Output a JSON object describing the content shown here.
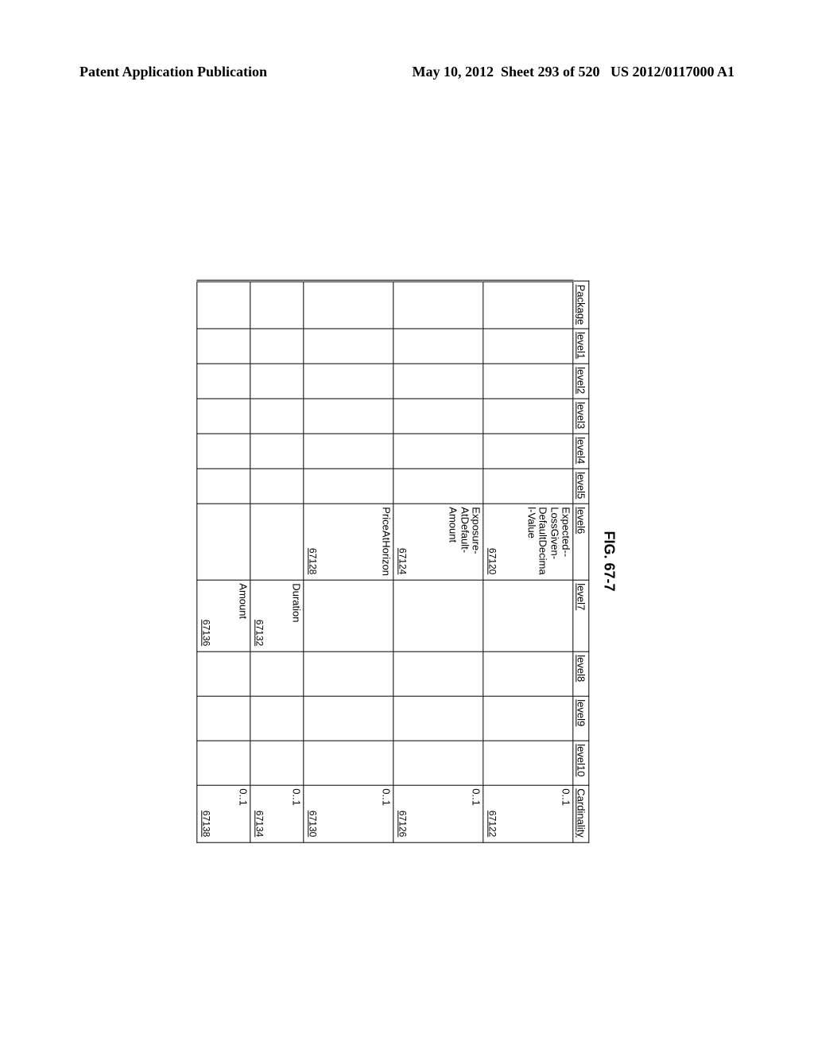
{
  "header": {
    "left": "Patent Application Publication",
    "date": "May 10, 2012",
    "sheet": "Sheet 293 of 520",
    "pubno": "US 2012/0117000 A1"
  },
  "figure": "FIG. 67-7",
  "columns": [
    "Package",
    "level1",
    "level2",
    "level3",
    "level4",
    "level5",
    "level6",
    "level7",
    "level8",
    "level9",
    "level10",
    "Cardinality"
  ],
  "rows": [
    {
      "height": "r-tall",
      "level6": {
        "text": "Expected-LossGivenDefaultDecimalValue",
        "ref": "67120"
      },
      "cardinality": {
        "text": "0..1",
        "ref": "67122"
      }
    },
    {
      "height": "r-tall",
      "level6": {
        "text": "ExposureAtDefaultAmount",
        "ref": "67124"
      },
      "cardinality": {
        "text": "0..1",
        "ref": "67126"
      }
    },
    {
      "height": "r-tall",
      "level6": {
        "text": "PriceAtHorizon",
        "ref": "67128"
      },
      "cardinality": {
        "text": "0..1",
        "ref": "67130"
      }
    },
    {
      "height": "r-mid",
      "level7": {
        "text": "Duration",
        "ref": "67132"
      },
      "cardinality": {
        "text": "0..1",
        "ref": "67134"
      }
    },
    {
      "height": "r-mid",
      "level7": {
        "text": "Amount",
        "ref": "67136"
      },
      "cardinality": {
        "text": "0..1",
        "ref": "67138"
      }
    }
  ]
}
